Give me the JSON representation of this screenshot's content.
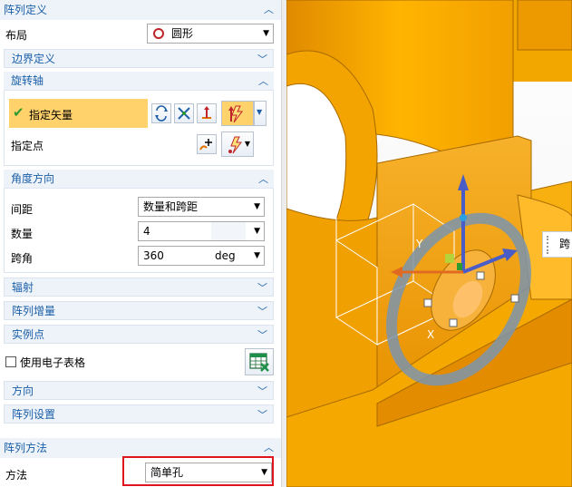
{
  "panel": {
    "pattern_definition": "阵列定义",
    "layout_label": "布局",
    "layout_value": "圆形",
    "boundary_definition": "边界定义",
    "rotation_axis": "旋转轴",
    "specify_vector": "指定矢量",
    "specify_point": "指定点",
    "angle_direction": "角度方向",
    "spacing_label": "间距",
    "spacing_value": "数量和跨距",
    "count_label": "数量",
    "count_value": "4",
    "span_label": "跨角",
    "span_value": "360",
    "span_unit": "deg",
    "radiate": "辐射",
    "pattern_increment": "阵列增量",
    "instance_points": "实例点",
    "use_spreadsheet": "使用电子表格",
    "direction": "方向",
    "pattern_settings": "阵列设置",
    "pattern_method": "阵列方法",
    "method_label": "方法",
    "method_value": "简单孔"
  },
  "viewport": {
    "axis_z": "Z",
    "axis_y": "Y",
    "axis_x": "X",
    "edge_label": "跨"
  },
  "colors": {
    "part": "#f5a500",
    "accent_blue": "#1a5fa8",
    "highlight": "#ffd26b",
    "red_box": "#e0141e"
  }
}
